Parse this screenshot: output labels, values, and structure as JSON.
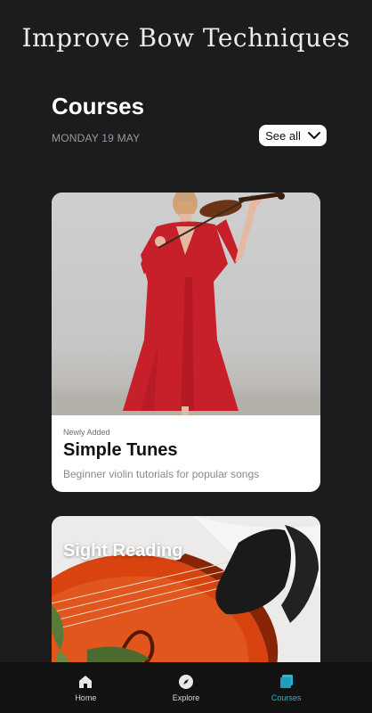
{
  "app": {
    "title": "Improve Bow Techniques"
  },
  "courses": {
    "heading": "Courses",
    "date": "MONDAY 19 MAY",
    "see_all_label": "See all"
  },
  "cards": [
    {
      "eyebrow": "Newly Added",
      "title": "Simple Tunes",
      "description": "Beginner violin tutorials for popular songs"
    },
    {
      "title": "Sight Reading"
    }
  ],
  "tabbar": {
    "items": [
      {
        "label": "Home",
        "icon": "home-icon"
      },
      {
        "label": "Explore",
        "icon": "compass-icon"
      },
      {
        "label": "Courses",
        "icon": "courses-icon"
      }
    ],
    "active": "Courses",
    "active_color": "#27b6d8"
  },
  "colors": {
    "background": "#1c1c1e",
    "tabbar": "#121212",
    "dress": "#c8202a"
  }
}
